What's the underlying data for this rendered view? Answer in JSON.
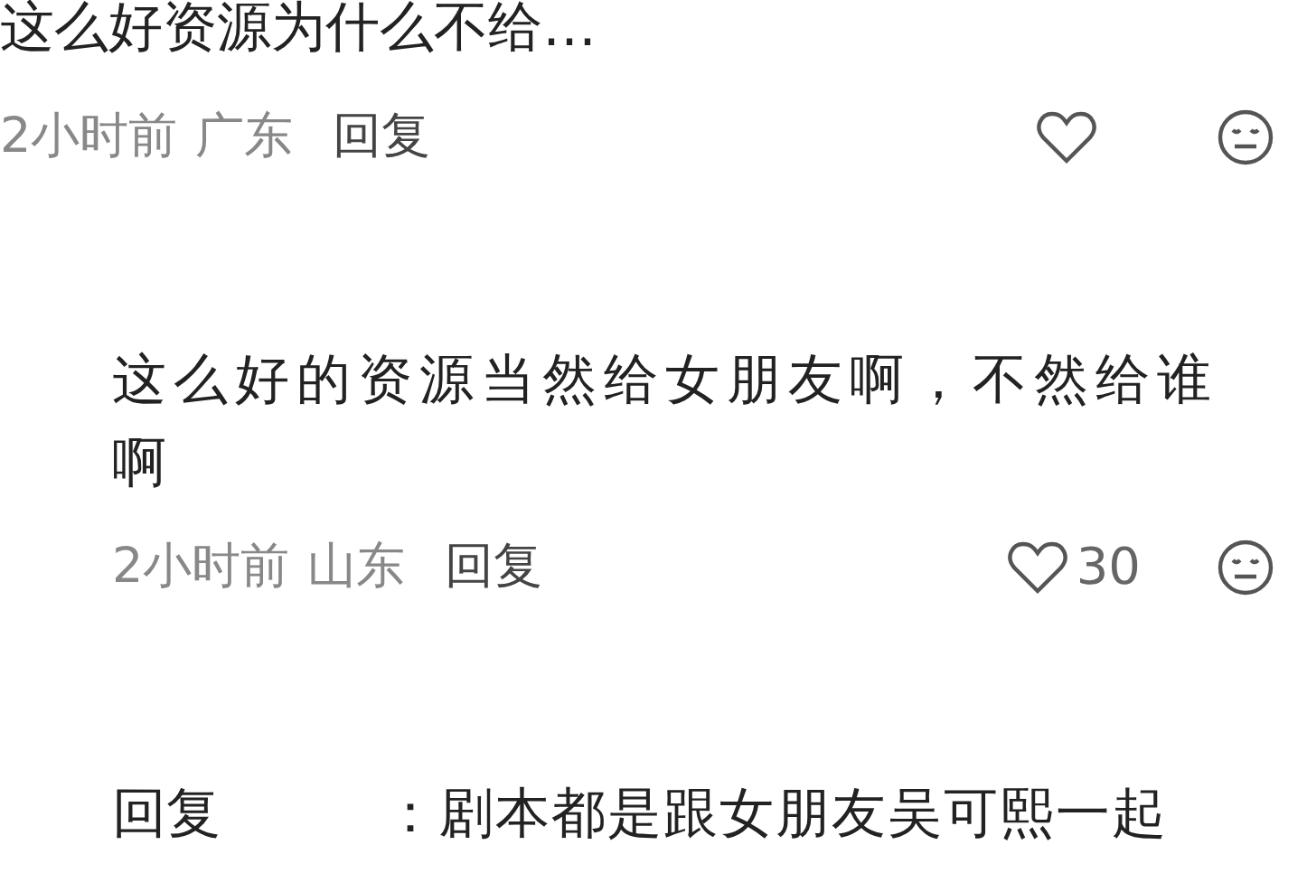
{
  "comments": [
    {
      "text": "这么好资源为什么不给…",
      "time": "2小时前",
      "location": "广东",
      "reply_label": "回复"
    },
    {
      "text": "这么好的资源当然给女朋友啊，不然给谁啊",
      "time": "2小时前",
      "location": "山东",
      "reply_label": "回复",
      "like_count": "30"
    }
  ],
  "partial_reply": {
    "prefix": "回复",
    "text": "：剧本都是跟女朋友吴可熙一起"
  }
}
